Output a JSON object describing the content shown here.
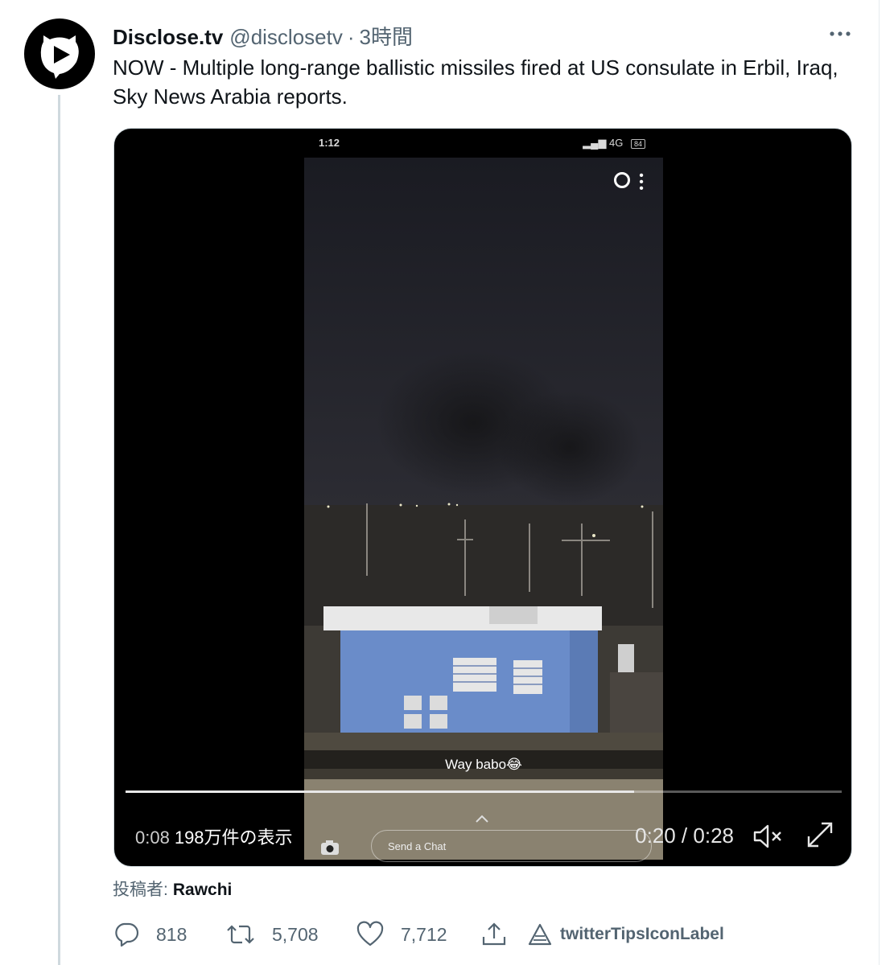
{
  "tweet": {
    "author_name": "Disclose.tv",
    "author_handle": "@disclosetv",
    "separator": "·",
    "time": "3時間",
    "text": "NOW - Multiple long-range ballistic missiles fired at US consulate in Erbil, Iraq, Sky News Arabia reports."
  },
  "video": {
    "phone_time": "1:12",
    "phone_network": "4G",
    "phone_battery": "84",
    "caption": "Way babo😂",
    "chat_placeholder": "Send a Chat",
    "elapsed_overlay": "0:08",
    "views": "198万件の表示",
    "duration": "0:20 / 0:28",
    "progress": 0.71
  },
  "attribution": {
    "label": "投稿者:",
    "poster": "Rawchi"
  },
  "actions": {
    "reply_count": "818",
    "retweet_count": "5,708",
    "like_count": "7,712",
    "tips_label": "twitterTipsIconLabel"
  },
  "colors": {
    "text_primary": "#0f1419",
    "text_secondary": "#536471",
    "border": "#cfd9de"
  }
}
